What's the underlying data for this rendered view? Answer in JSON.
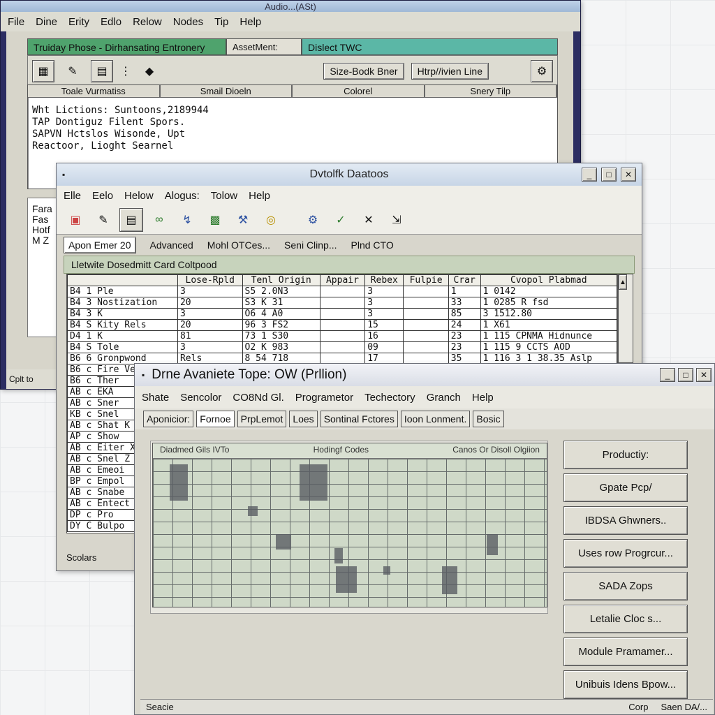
{
  "window1": {
    "title": "Audio...(ASt)",
    "menu": [
      "File",
      "Dine",
      "Erity",
      "Edlo",
      "Relow",
      "Nodes",
      "Tip",
      "Help"
    ],
    "tabs": [
      "Truiday Phose - Dirhansating Entronery",
      "AssetMent: Ainer",
      "Dislect TWC"
    ],
    "buttons": {
      "size_mode": "Size-Bodk Bner",
      "http_line": "Htrp//ivien Line"
    },
    "table_headers": [
      "Toale Vurmatiss",
      "Smail Dioeln",
      "Colorel",
      "Snery Tilp"
    ],
    "lines": [
      "Wht Lictions: Suntoons,2189944",
      "TAP Dontiguz Filent Spors.",
      "SAPVN Hctslos Wisonde, Upt",
      "Reactoor, Lioght Searnel"
    ],
    "lower_lines": [
      "Fara",
      "Fas",
      "Hotf",
      "M Z"
    ],
    "status": "Cplt to"
  },
  "window2": {
    "title": "Dvtolfk Daatoos",
    "menu": [
      "Elle",
      "Eelo",
      "Helow",
      "Alogus:",
      "Tolow",
      "Help"
    ],
    "tabs": [
      "Apon Emer 20",
      "Advanced",
      "Mohl OTCes...",
      "Seni Clinp...",
      "Plnd CTO"
    ],
    "group_title": "Lletwite Dosedmitt Card Coltpood",
    "grid_headers": [
      "",
      "Lose-Rpld",
      "Tenl Origin",
      "Appair",
      "Rebex",
      "Fulpie",
      "Crar",
      "Cvopol Plabmad"
    ],
    "rows": [
      [
        "B4 1 Ple",
        "3",
        "S5 2.0N3",
        "",
        "3",
        "",
        "1",
        "1 0142"
      ],
      [
        "B4 3 Nostization",
        "20",
        "S3 K 31",
        "",
        "3",
        "",
        "33",
        "1 0285 R fsd"
      ],
      [
        "B4 3 K",
        "3",
        "O6 4 A0",
        "",
        "3",
        "",
        "85",
        "3 1512.80"
      ],
      [
        "B4 S Kity Rels",
        "20",
        "96 3 FS2",
        "",
        "15",
        "",
        "24",
        "1 X61"
      ],
      [
        "D4 1 K",
        "81",
        "73 1 S30",
        "",
        "16",
        "",
        "23",
        "1 115 CPNMA Hidnunce"
      ],
      [
        "B4 S Tole",
        "3",
        "O2 K 983",
        "",
        "09",
        "",
        "23",
        "1 115 9 CCTS AOD"
      ],
      [
        "B6 6 Gronpwond",
        "Rels",
        "8 54 718",
        "",
        "17",
        "",
        "35",
        "1 116 3 1 38.35 Aslp"
      ],
      [
        "B6 c Fire Ver",
        "",
        "",
        "",
        "",
        "",
        "",
        ""
      ],
      [
        "B6 c Ther",
        "",
        "",
        "",
        "",
        "",
        "",
        ""
      ],
      [
        "AB c EKA",
        "",
        "",
        "",
        "",
        "",
        "",
        ""
      ],
      [
        "AB c Sner",
        "",
        "",
        "",
        "",
        "",
        "",
        ""
      ],
      [
        "KB c Snel",
        "",
        "",
        "",
        "",
        "",
        "",
        ""
      ],
      [
        "AB c Shat K",
        "",
        "",
        "",
        "",
        "",
        "",
        ""
      ],
      [
        "AP c Show",
        "",
        "",
        "",
        "",
        "",
        "",
        ""
      ],
      [
        "AB c Eiter X",
        "",
        "",
        "",
        "",
        "",
        "",
        ""
      ],
      [
        "AB c Snel Z",
        "",
        "",
        "",
        "",
        "",
        "",
        ""
      ],
      [
        "AB c Emeoi",
        "",
        "",
        "",
        "",
        "",
        "",
        ""
      ],
      [
        "BP c Empol",
        "",
        "",
        "",
        "",
        "",
        "",
        ""
      ],
      [
        "AB c Snabe",
        "",
        "",
        "",
        "",
        "",
        "",
        ""
      ],
      [
        "AB c Entect",
        "",
        "",
        "",
        "",
        "",
        "",
        ""
      ],
      [
        "DP c Pro",
        "",
        "",
        "",
        "",
        "",
        "",
        ""
      ],
      [
        "DY C Bulpo",
        "",
        "",
        "",
        "",
        "",
        "",
        ""
      ]
    ],
    "status": "Scolars"
  },
  "window3": {
    "title": "Drne Avaniete Tope: OW (Prllion)",
    "menu": [
      "Shate",
      "Sencolor",
      "CO8Nd Gl.",
      "Programetor",
      "Techectory",
      "Granch",
      "Help"
    ],
    "tabs": [
      "Aponicior:",
      "Fornoe",
      "PrpLemot",
      "Loes",
      "Sontinal Fctores",
      "Ioon Lonment.",
      "Bosic"
    ],
    "map_headers": [
      "Diadmed Gils IVTo",
      "Hodingf Codes",
      "Canos Or Disoll Olgiion"
    ],
    "buttons": [
      "Productiy:",
      "Gpate Pcp/",
      "IBDSA Ghwners..",
      "Uses row Progrcur...",
      "SADA Zops",
      "Letalie Cloc s...",
      "Module Pramamer...",
      "Unibuis Idens Bpow..."
    ],
    "status_left": "Seacie",
    "status_right": [
      "Corp",
      "Saen DA/..."
    ]
  },
  "colors": {
    "win1_frame": "#2c2d62",
    "tab_green": "#4fa36d",
    "tab_teal": "#5bb7a6",
    "group_green": "#c7d3bc",
    "map_green": "#cfd9c8"
  }
}
